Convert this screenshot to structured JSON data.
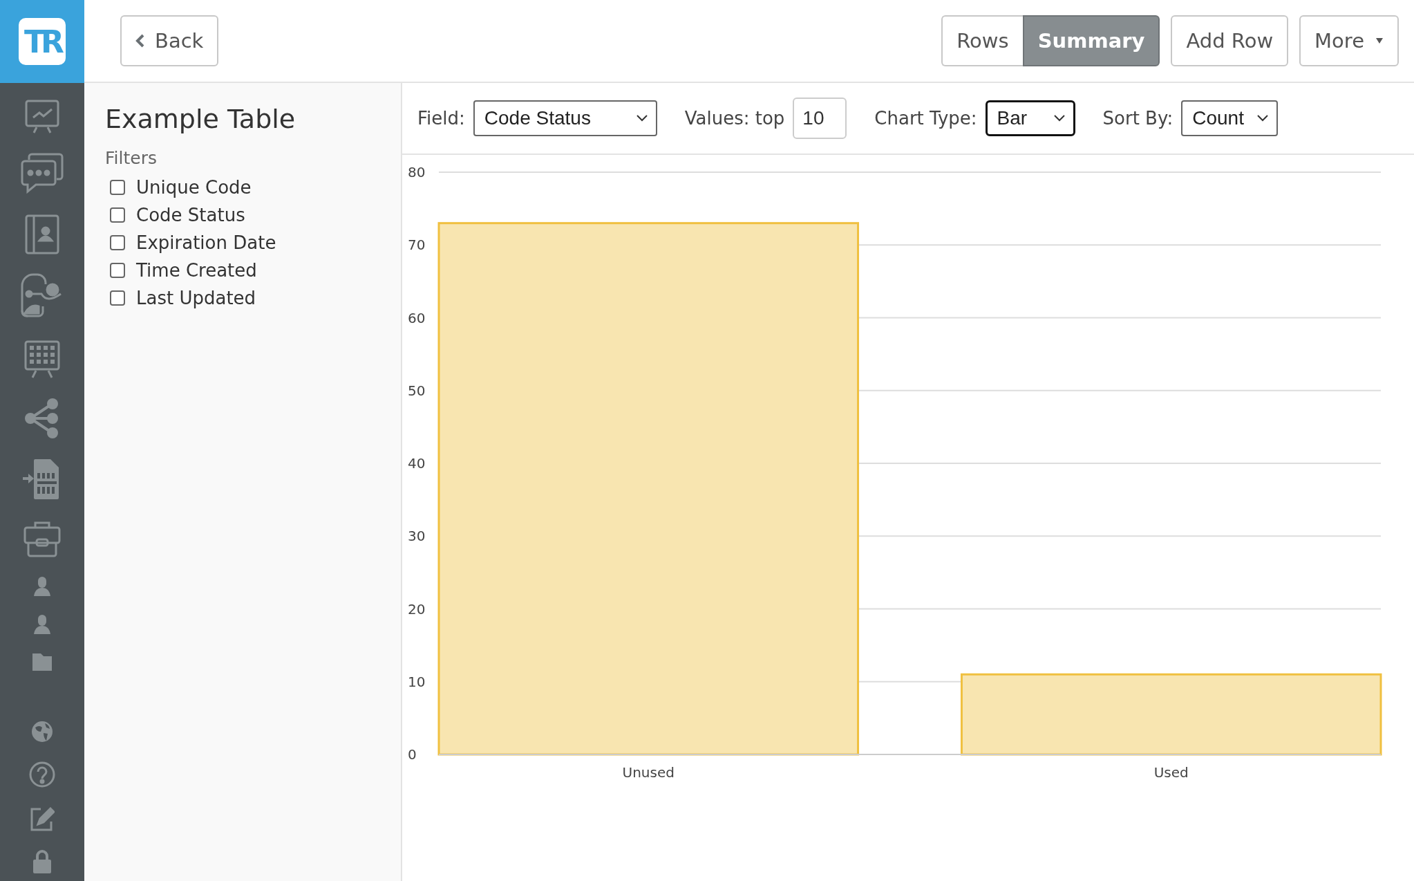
{
  "logo_text": "TR",
  "header": {
    "back_button": "Back",
    "view_toggle": [
      {
        "label": "Rows",
        "selected": false
      },
      {
        "label": "Summary",
        "selected": true
      }
    ],
    "add_row_button": "Add Row",
    "more_button": "More"
  },
  "panel": {
    "title": "Example Table",
    "filters_label": "Filters",
    "filters": [
      {
        "label": "Unique Code",
        "checked": false
      },
      {
        "label": "Code Status",
        "checked": false
      },
      {
        "label": "Expiration Date",
        "checked": false
      },
      {
        "label": "Time Created",
        "checked": false
      },
      {
        "label": "Last Updated",
        "checked": false
      }
    ]
  },
  "controls": {
    "field": {
      "label": "Field:",
      "value": "Code Status"
    },
    "values": {
      "label": "Values: top",
      "value": "10"
    },
    "chart_type": {
      "label": "Chart Type:",
      "value": "Bar",
      "focused": true
    },
    "sort_by": {
      "label": "Sort By:",
      "value": "Count"
    }
  },
  "chart_data": {
    "type": "bar",
    "grid": true,
    "categories": [
      "Unused",
      "Used"
    ],
    "values": [
      73,
      11
    ],
    "ylim": [
      0,
      80
    ],
    "yticks": [
      0,
      10,
      20,
      30,
      40,
      50,
      60,
      70,
      80
    ]
  }
}
